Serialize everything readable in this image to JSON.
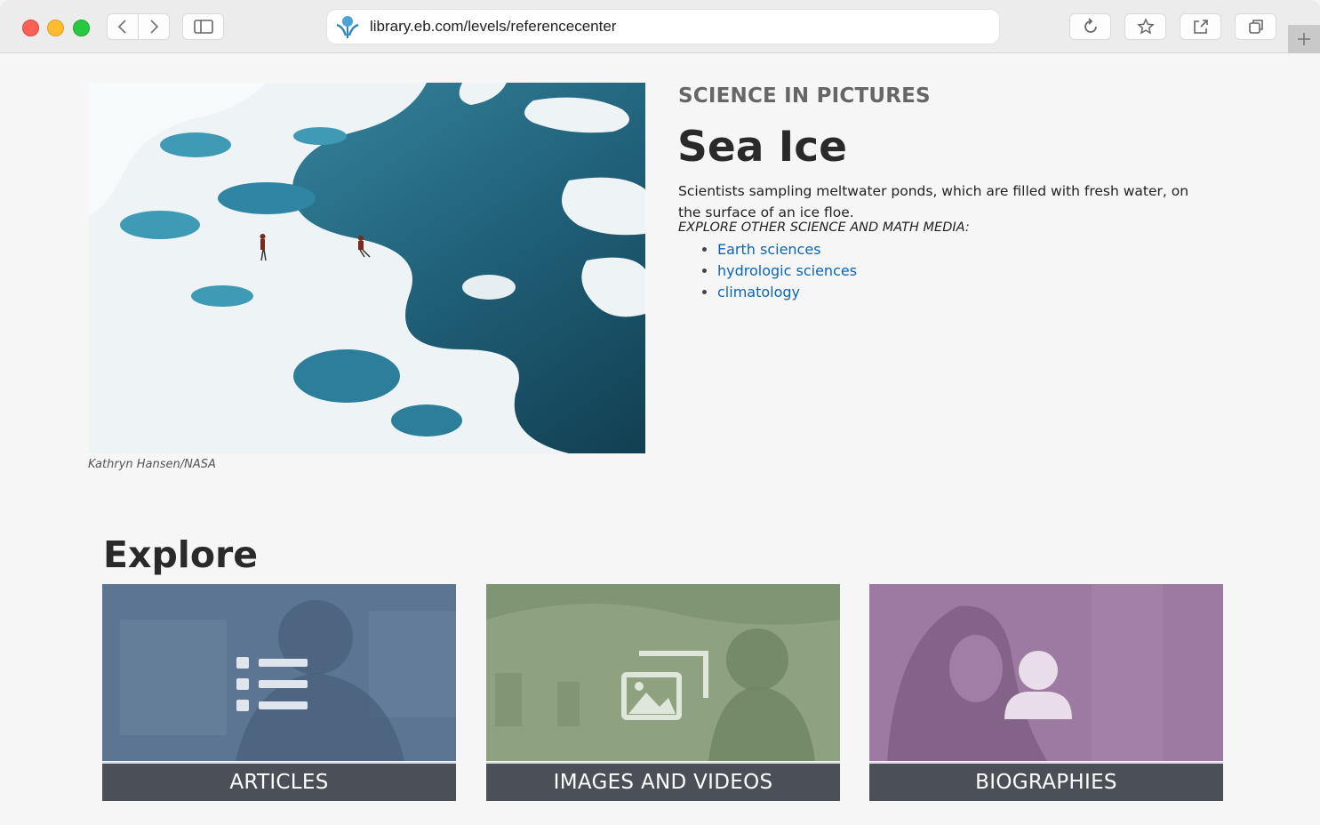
{
  "browser": {
    "url": "library.eb.com/levels/referencecenter",
    "icons": [
      "sidebar-icon",
      "back-icon",
      "forward-icon",
      "reload-icon",
      "bookmark-star-icon",
      "share-icon",
      "tabs-icon",
      "new-tab-icon"
    ]
  },
  "feature": {
    "eyebrow": "SCIENCE IN PICTURES",
    "title": "Sea Ice",
    "description": "Scientists sampling meltwater ponds, which are filled with fresh water, on the surface of an ice floe.",
    "explore_label": "EXPLORE OTHER SCIENCE AND MATH MEDIA:",
    "links": [
      "Earth sciences",
      "hydrologic sciences",
      "climatology"
    ],
    "photo_credit": "Kathryn Hansen/NASA"
  },
  "explore": {
    "heading": "Explore",
    "cards": [
      {
        "label": "ARTICLES",
        "icon": "list-icon",
        "tint": "#5b7592"
      },
      {
        "label": "IMAGES AND VIDEOS",
        "icon": "images-icon",
        "tint": "#8ea280"
      },
      {
        "label": "BIOGRAPHIES",
        "icon": "person-icon",
        "tint": "#9d7aa1"
      }
    ]
  },
  "colors": {
    "link": "#0b65b4",
    "card_bar": "#4a4f58"
  }
}
